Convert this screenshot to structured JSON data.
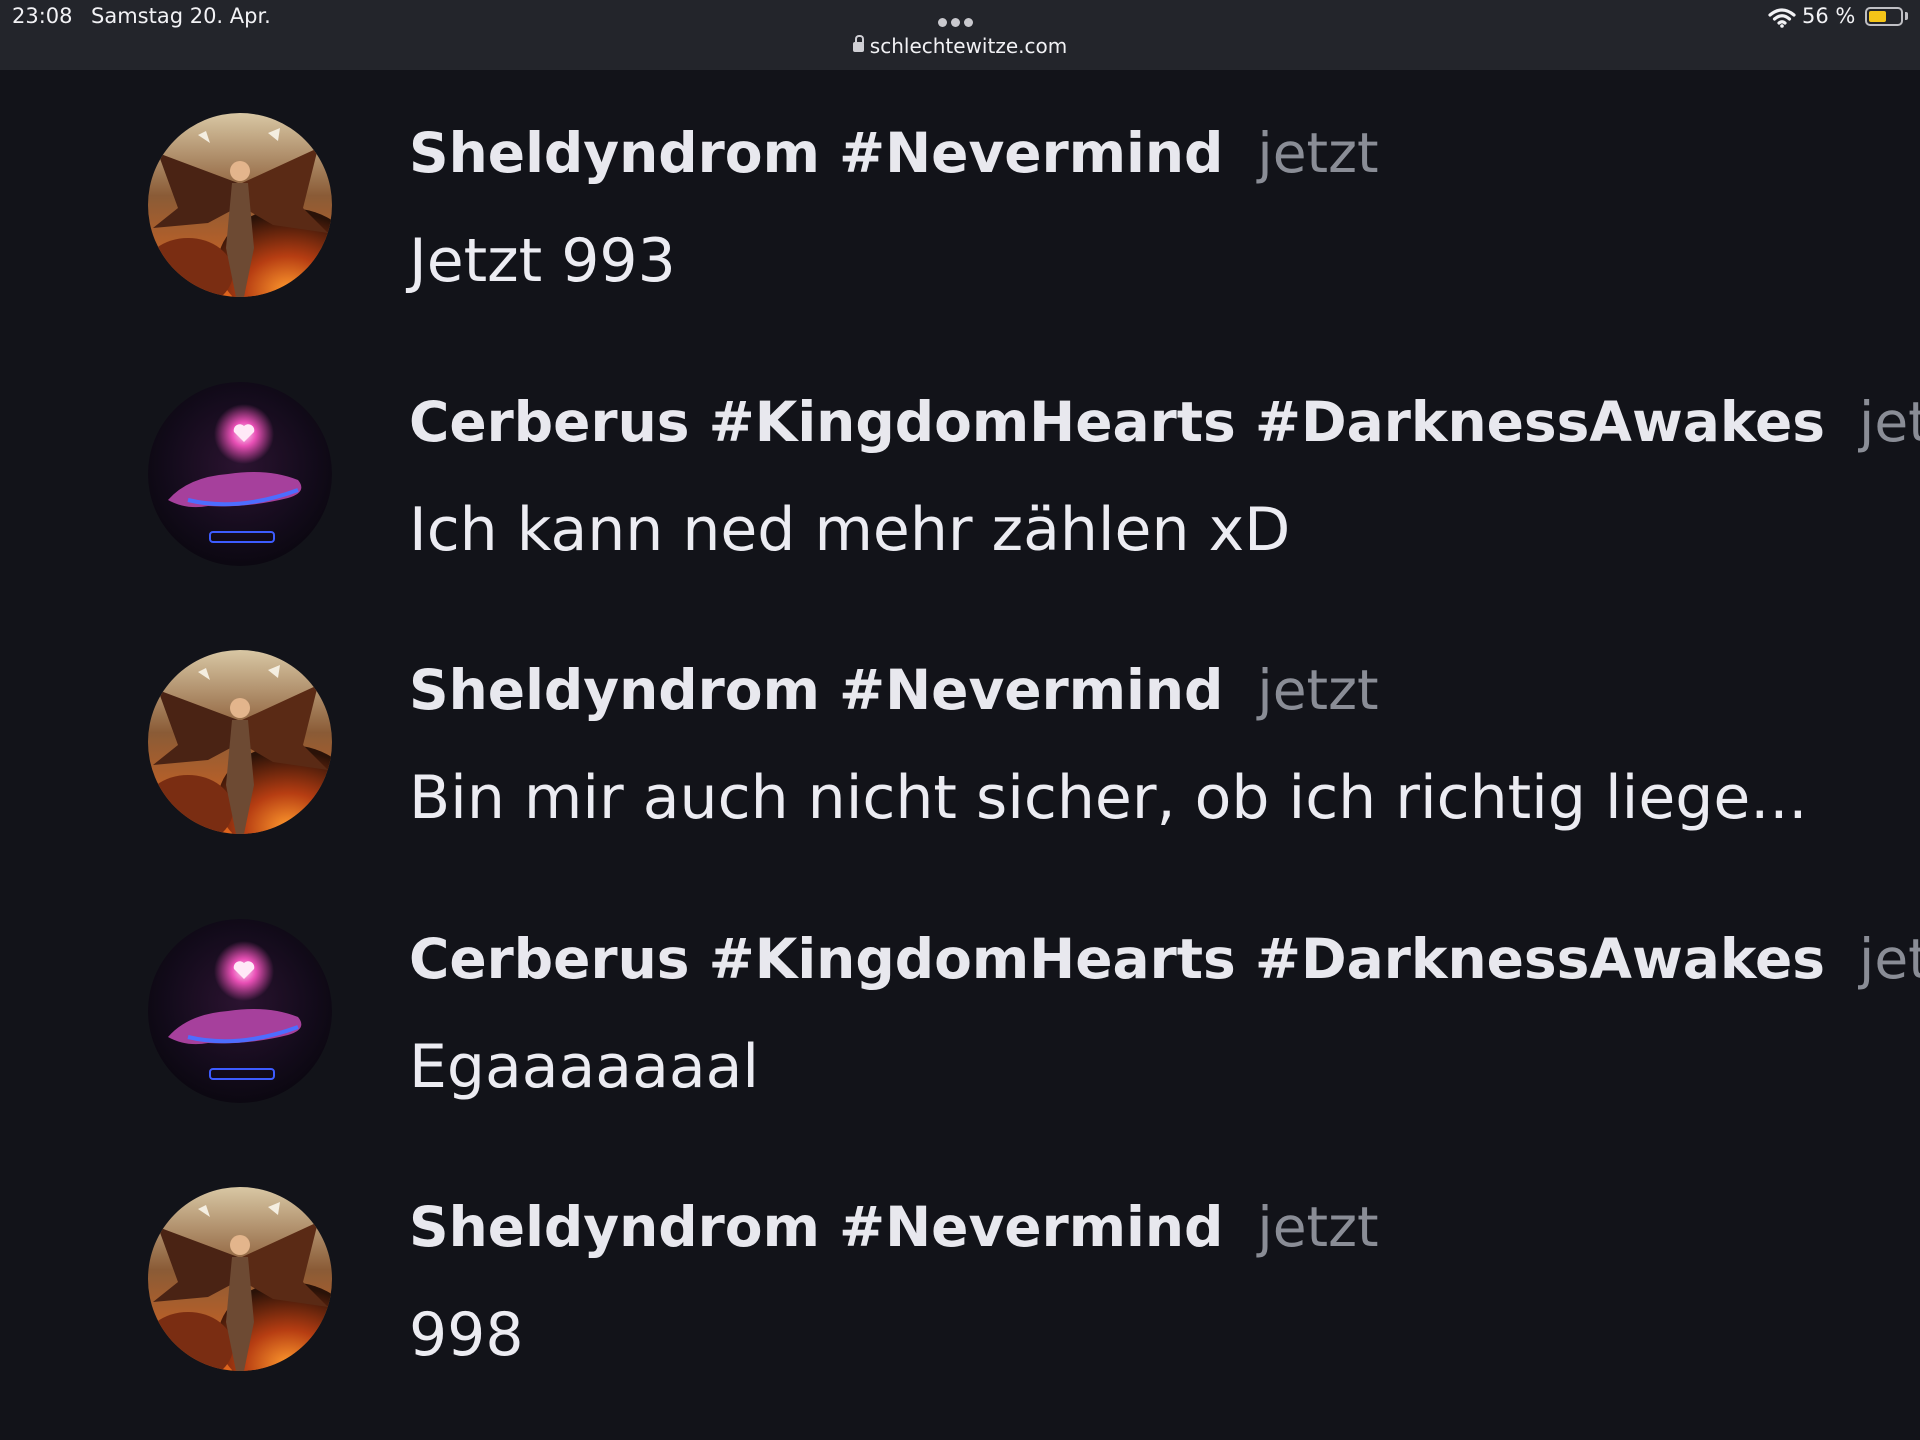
{
  "status_bar": {
    "time": "23:08",
    "date": "Samstag 20. Apr.",
    "url": "schlechtewitze.com",
    "battery": "56 %",
    "battery_fraction": 0.56
  },
  "messages": [
    {
      "author": "Sheldyndrom #Nevermind",
      "time": "jetzt",
      "text": "Jetzt 993",
      "avatar": "angel-avatar"
    },
    {
      "author": "Cerberus #KingdomHearts #DarknessAwakes",
      "time": "jetzt",
      "text": "Ich kann ned mehr zählen xD",
      "avatar": "heart-avatar"
    },
    {
      "author": "Sheldyndrom #Nevermind",
      "time": "jetzt",
      "text": "Bin mir auch nicht sicher, ob ich richtig liege...",
      "avatar": "angel-avatar"
    },
    {
      "author": "Cerberus #KingdomHearts #DarknessAwakes",
      "time": "jetzt",
      "text": "Egaaaaaaal",
      "avatar": "heart-avatar"
    },
    {
      "author": "Sheldyndrom #Nevermind",
      "time": "jetzt",
      "text": "998",
      "avatar": "angel-avatar"
    }
  ]
}
